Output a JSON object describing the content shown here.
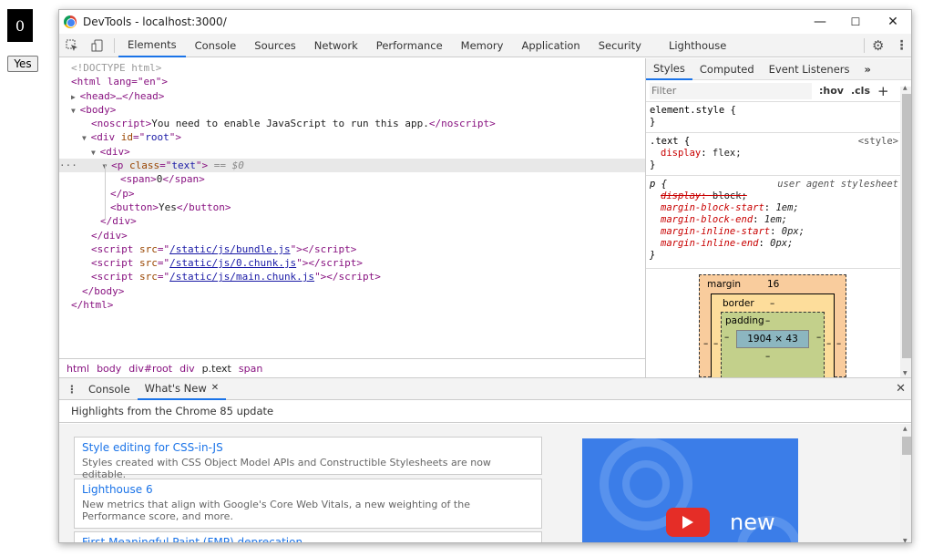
{
  "page": {
    "counter": "0",
    "button_label": "Yes"
  },
  "window": {
    "title": "DevTools - localhost:3000/",
    "min_glyph": "—",
    "max_glyph": "☐",
    "close_glyph": "✕"
  },
  "tabs": [
    "Elements",
    "Console",
    "Sources",
    "Network",
    "Performance",
    "Memory",
    "Application",
    "Security",
    "Lighthouse"
  ],
  "active_tab": "Elements",
  "dom": {
    "doctype": "<!DOCTYPE html>",
    "html_open": "<html lang=\"en\">",
    "head": "<head>…</head>",
    "body_open": "<body>",
    "noscript_text": "You need to enable JavaScript to run this app.",
    "root_id": "root",
    "p_class": "text",
    "selected_marker": "== $0",
    "span_text": "0",
    "button_text": "Yes",
    "scripts": [
      "/static/js/bundle.js",
      "/static/js/0.chunk.js",
      "/static/js/main.chunk.js"
    ]
  },
  "breadcrumbs": [
    "html",
    "body",
    "div#root",
    "div",
    "p.text",
    "span"
  ],
  "styles": {
    "tabs": [
      "Styles",
      "Computed",
      "Event Listeners"
    ],
    "more": "»",
    "filter_placeholder": "Filter",
    "hov": ":hov",
    "cls": ".cls",
    "add": "+",
    "element_style": "element.style {",
    "text_selector": ".text {",
    "text_source": "<style>",
    "text_props": [
      {
        "name": "display",
        "value": "flex;"
      }
    ],
    "ua_selector": "p {",
    "ua_source": "user agent stylesheet",
    "ua_props": [
      {
        "name": "display",
        "value": "block;",
        "struck": true
      },
      {
        "name": "margin-block-start",
        "value": "1em;"
      },
      {
        "name": "margin-block-end",
        "value": "1em;"
      },
      {
        "name": "margin-inline-start",
        "value": "0px;"
      },
      {
        "name": "margin-inline-end",
        "value": "0px;"
      }
    ],
    "close_brace": "}"
  },
  "box_model": {
    "margin_label": "margin",
    "margin_value": "16",
    "border_label": "border",
    "border_value": "–",
    "padding_label": "padding",
    "padding_value": "–",
    "content": "1904 × 43",
    "dash": "–"
  },
  "drawer": {
    "tabs": [
      "Console",
      "What's New"
    ],
    "active_tab": "What's New",
    "headline": "Highlights from the Chrome 85 update",
    "items": [
      {
        "title": "Style editing for CSS-in-JS",
        "desc": "Styles created with CSS Object Model APIs and Constructible Stylesheets are now editable."
      },
      {
        "title": "Lighthouse 6",
        "desc": "New metrics that align with Google's Core Web Vitals, a new weighting of the Performance score, and more."
      },
      {
        "title": "First Meaningful Paint (FMP) deprecation",
        "desc": ""
      }
    ],
    "promo_text": "new"
  },
  "colors": {
    "accent": "#1a73e8",
    "tag": "#881280",
    "attr": "#994500",
    "value": "#1a1aa6"
  }
}
